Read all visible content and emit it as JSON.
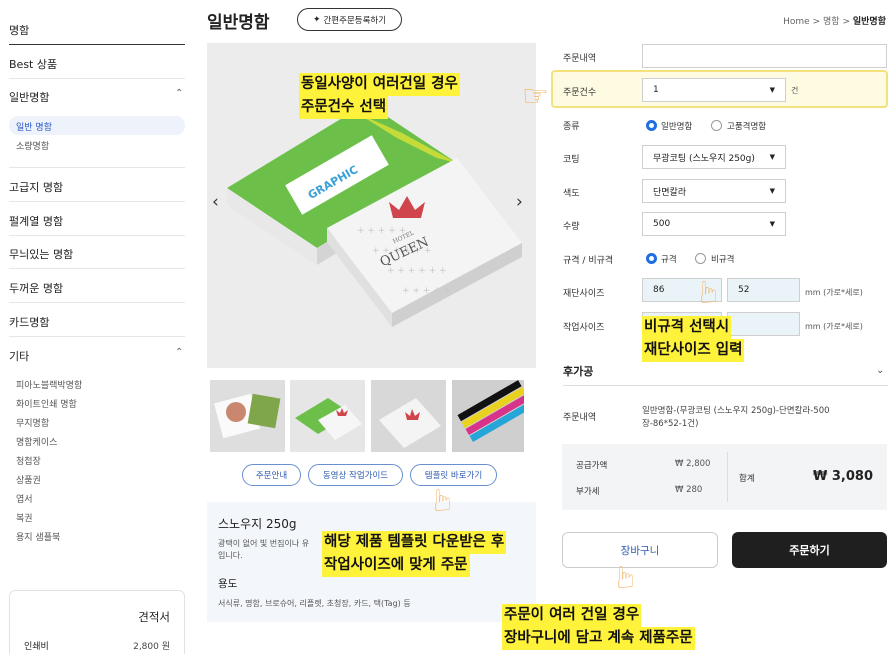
{
  "sidebar": {
    "title": "명함",
    "categories": [
      {
        "label": "Best 상품"
      },
      {
        "label": "일반명함"
      },
      {
        "label": "고급지 명함"
      },
      {
        "label": "펄계열 명함"
      },
      {
        "label": "무늬있는 명함"
      },
      {
        "label": "두꺼운 명함"
      },
      {
        "label": "카드명함"
      },
      {
        "label": "기타"
      }
    ],
    "sub_general": [
      "일반 명함",
      "소량명함"
    ],
    "sub_other": [
      "피아노블랙박명함",
      "화이트인쇄 명함",
      "무지명함",
      "명함케이스",
      "청첩장",
      "상품권",
      "엽서",
      "복권",
      "용지 샘플북"
    ]
  },
  "estimate": {
    "title": "견적서",
    "label": "인쇄비",
    "value": "2,800 원"
  },
  "header": {
    "title": "일반명함",
    "quick_button": "간편주문등록하기",
    "breadcrumb": [
      "Home",
      "명함",
      "일반명함"
    ],
    "separator": ">"
  },
  "product": {
    "image_text": {
      "graphic": "GRAPHIC",
      "hotel": "HOTEL",
      "queen": "QUEEN"
    },
    "prev": "‹",
    "next": "›",
    "buttons": [
      "주문안내",
      "동영상 작업가이드",
      "템플릿 바로가기"
    ],
    "paper_name": "스노우지 250g",
    "paper_desc": "광택이 없어 빛 번짐이나 유 입니다.",
    "use_title": "용도",
    "use_text": "서식류, 명함, 브로슈어, 리플렛, 초청장, 카드, 택(Tag) 등"
  },
  "form": {
    "order_content_label": "주문내역",
    "order_content_value": "",
    "count_label": "주문건수",
    "count_value": "1",
    "count_unit": "건",
    "type_label": "종류",
    "type_options": [
      "일반명함",
      "고품격명함"
    ],
    "coating_label": "코팅",
    "coating_value": "무광코팅 (스노우지 250g)",
    "color_label": "색도",
    "color_value": "단면칼라",
    "qty_label": "수량",
    "qty_value": "500",
    "size_type_label": "규격 / 비규격",
    "size_type_options": [
      "규격",
      "비규격"
    ],
    "cut_label": "재단사이즈",
    "cut_w": "86",
    "cut_h": "52",
    "size_unit": "mm (가로*세로)",
    "work_label": "작업사이즈"
  },
  "after": {
    "title": "후가공",
    "summary_label": "주문내역",
    "summary_value": "일반명함-(무광코팅 (스노우지 250g)-단면칼라-500장-86*52-1건)"
  },
  "totals": {
    "supply_label": "공급가액",
    "supply_value": "₩ 2,800",
    "vat_label": "부가세",
    "vat_value": "₩ 280",
    "total_label": "합계",
    "total_value": "₩ 3,080"
  },
  "actions": {
    "cart": "장바구니",
    "order": "주문하기"
  },
  "notes": {
    "count_1": "동일사양이 여러건일 경우",
    "count_2": "주문건수 선택",
    "size_1": "비규격 선택시",
    "size_2": "재단사이즈 입력",
    "tpl_1": "해당 제품 템플릿 다운받은 후",
    "tpl_2": "작업사이즈에 맞게 주문",
    "cart_1": "주문이 여러 건일 경우",
    "cart_2": "장바구니에 담고 계속 제품주문"
  },
  "colors": {
    "accent": "#1f6fe0",
    "highlight": "#fff23b",
    "order_button": "#1f1f1f"
  }
}
